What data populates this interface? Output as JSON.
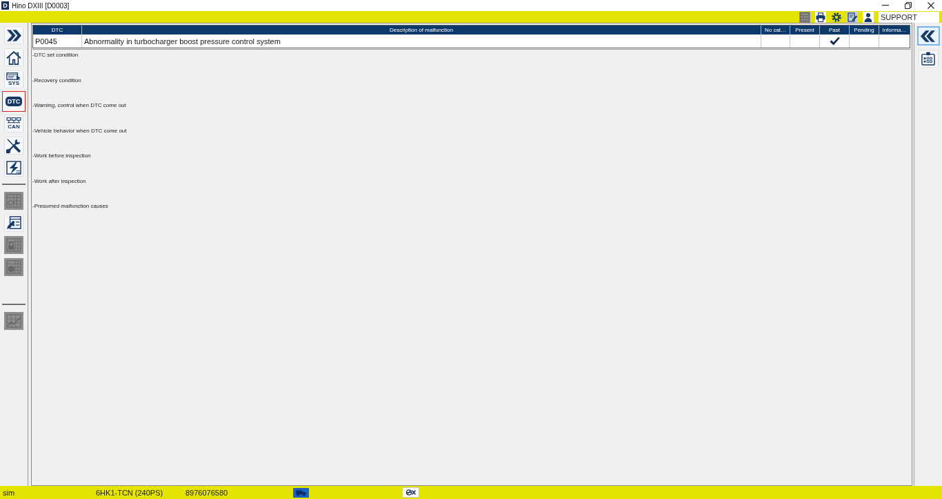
{
  "title_bar": {
    "app_letter": "D",
    "title": "Hino DXIII [D0003]"
  },
  "toolbar": {
    "buttons": [
      {
        "disabled": true
      },
      {
        "disabled": false
      },
      {
        "disabled": false
      },
      {
        "disabled": false
      },
      {
        "disabled": false
      }
    ],
    "user_field": {
      "value": "SUPPORT"
    }
  },
  "left_sidebar": {
    "groups": [
      {
        "items": [
          {
            "selected": false,
            "disabled": false
          },
          {
            "selected": false,
            "disabled": false
          },
          {
            "label": "SYS",
            "selected": false,
            "disabled": false
          },
          {
            "label": "DTC",
            "selected": true,
            "disabled": false
          },
          {
            "label": "CAN",
            "selected": false,
            "disabled": false
          },
          {
            "selected": false,
            "disabled": false
          },
          {
            "selected": false,
            "disabled": false
          }
        ]
      },
      {
        "items": [
          {
            "selected": false,
            "disabled": true
          },
          {
            "selected": false,
            "disabled": false
          },
          {
            "selected": false,
            "disabled": true
          },
          {
            "selected": false,
            "disabled": true
          }
        ]
      },
      {
        "items": [
          {
            "selected": false,
            "disabled": true
          }
        ]
      }
    ]
  },
  "table": {
    "columns": [
      "DTC",
      "Description of malfunction",
      "No cat…",
      "Present",
      "Past",
      "Pending",
      "Informa…"
    ],
    "rows": [
      {
        "dtc": "P0045",
        "description": "Abnormality in turbocharger boost pressure control system",
        "status": [
          {
            "checked": false
          },
          {
            "checked": false
          },
          {
            "checked": true
          },
          {
            "checked": false
          },
          {
            "checked": false
          }
        ]
      }
    ]
  },
  "sections": [
    "-DTC set condition",
    "-Recovery condition",
    "-Warning, control when DTC come out",
    "-Vehicle behavior when DTC come out",
    "-Work before inspection",
    "-Work after inspection",
    "-Presumed malfunction causes"
  ],
  "right_sidebar": {
    "items": [
      {
        "focused": true
      },
      {
        "focused": false
      }
    ]
  },
  "status_bar": {
    "fields": [
      "sim",
      "6HK1-TCN (240PS)",
      "8976076580"
    ]
  }
}
